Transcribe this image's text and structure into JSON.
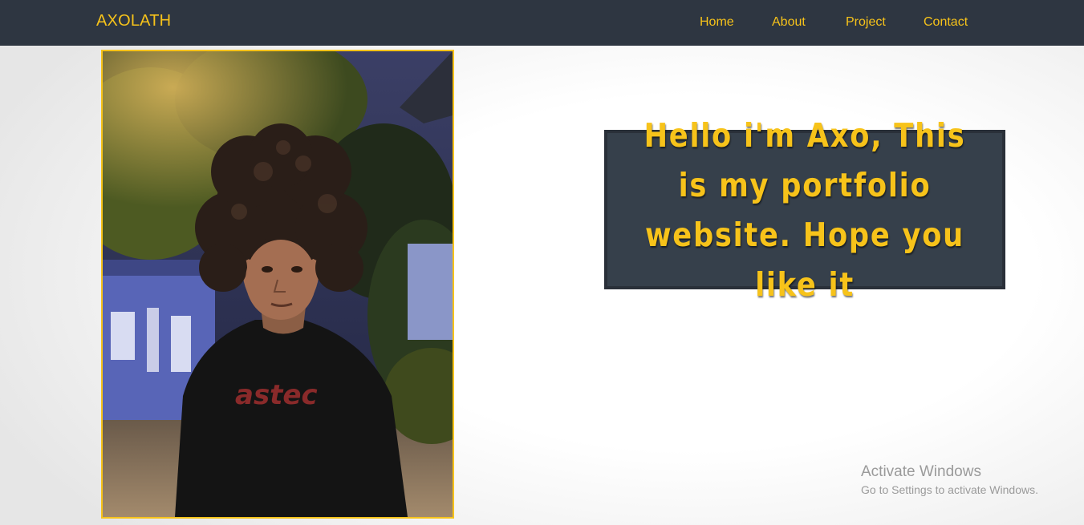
{
  "navbar": {
    "brand": "AXOLATH",
    "links": [
      {
        "label": "Home"
      },
      {
        "label": "About"
      },
      {
        "label": "Project"
      },
      {
        "label": "Contact"
      }
    ]
  },
  "hero": {
    "image_subject": "portrait photo of a person with curly hair at night",
    "message": "Hello i'm Axo, This is my portfolio website. Hope you like it"
  },
  "watermark": {
    "title": "Activate Windows",
    "subtitle": "Go to Settings to activate Windows."
  },
  "colors": {
    "accent": "#f7c31a",
    "navbar_bg": "#2e3641",
    "hero_box_bg": "#36404b"
  }
}
